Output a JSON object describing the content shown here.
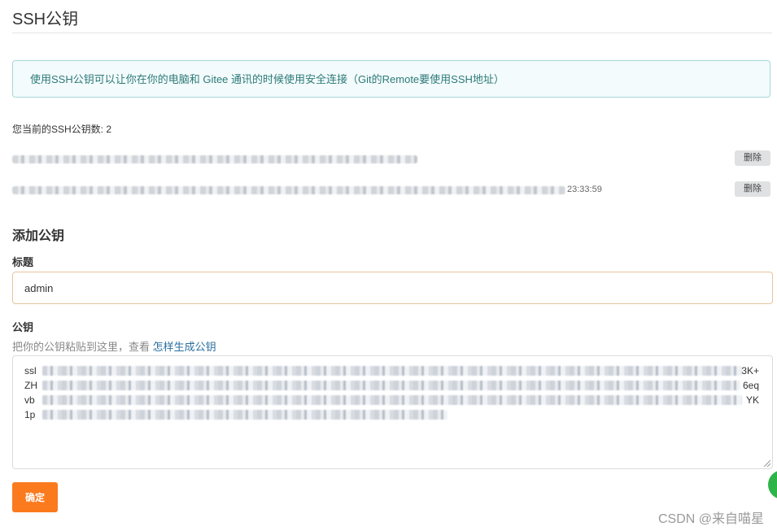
{
  "page": {
    "title": "SSH公钥"
  },
  "info": {
    "text": "使用SSH公钥可以让你在你的电脑和 Gitee 通讯的时候使用安全连接（Git的Remote要使用SSH地址）"
  },
  "keys": {
    "count_label": "您当前的SSH公钥数: 2",
    "items": [
      {
        "time": "",
        "delete_label": "删除"
      },
      {
        "time": "23:33:59",
        "delete_label": "删除"
      }
    ]
  },
  "form": {
    "section_title": "添加公钥",
    "title_label": "标题",
    "title_value": "admin",
    "key_label": "公钥",
    "hint_text": "把你的公钥粘贴到这里，查看 ",
    "hint_link": "怎样生成公钥",
    "key_lines": [
      {
        "start": "ssl",
        "end": "3K+"
      },
      {
        "start": "ZH",
        "end": "6eq"
      },
      {
        "start": "vb",
        "end": "YK"
      },
      {
        "start": "1p",
        "end": ""
      }
    ],
    "submit_label": "确定"
  },
  "watermark": {
    "text": "CSDN @来自喵星"
  },
  "colors": {
    "accent_orange": "#fc7a1e",
    "info_text": "#2b7a78",
    "link": "#2b6f9e",
    "float_green": "#2fb44a"
  }
}
